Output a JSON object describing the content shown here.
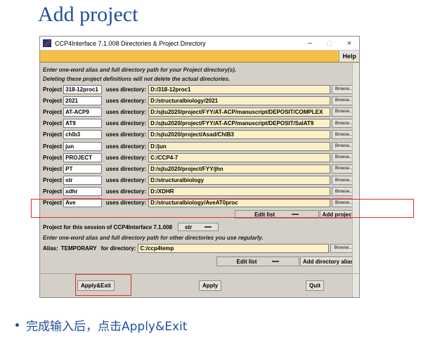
{
  "slide": {
    "title": "Add project",
    "bullet": "完成输入后，点击Apply&Exit"
  },
  "window": {
    "title": "CCP4Interface 7.1.008 Directories & Project Directory",
    "minimize": "−",
    "maximize": "□",
    "close": "×",
    "help": "Help"
  },
  "info": {
    "line1": "Enter one-word alias and full directory path for your Project directory(s).",
    "line2": "Deleting these project definitions will not delete the actual directories."
  },
  "labels": {
    "project": "Project",
    "uses_directory": "uses directory:",
    "browse": "Browse..."
  },
  "projects": [
    {
      "alias": "318-12proc1",
      "dir": "D:/318-12proc1"
    },
    {
      "alias": "2021",
      "dir": "D:/structuralbiology/2021"
    },
    {
      "alias": "AT-ACP9",
      "dir": "D:/sjtu2020/project/FYY/AT-ACP/manuscript/DEPOSIT/COMPLEX"
    },
    {
      "alias": "AT9",
      "dir": "D:/sjtu2020/project/FYY/AT-ACP/manuscript/DEPOSIT/SalAT9"
    },
    {
      "alias": "chlb3",
      "dir": "D:/sjtu2020/project/Asad/ChlB3"
    },
    {
      "alias": "jun",
      "dir": "D:/jun"
    },
    {
      "alias": "PROJECT",
      "dir": "C:/CCP4-7"
    },
    {
      "alias": "PT",
      "dir": "D:/sjtu2020/project/FYY/jhn"
    },
    {
      "alias": "str",
      "dir": "D:/structuralbiology"
    },
    {
      "alias": "xdhr",
      "dir": "D:/XDHR"
    },
    {
      "alias": "Ave",
      "dir": "D:/structuralbiology/AveAT0proc"
    }
  ],
  "project_controls": {
    "edit_list": "Edit list",
    "add_project": "Add project"
  },
  "session": {
    "label": "Project for this session of CCP4Interface 7.1.008",
    "value": "str"
  },
  "other_dirs": {
    "info": "Enter one-word alias and full directory path for other directories you use regularly.",
    "alias_label": "Alias:",
    "alias_value": "TEMPORARY",
    "for_directory": "for directory:",
    "dir_value": "C:/ccp4temp",
    "edit_list": "Edit list",
    "add_directory_alias": "Add directory alias"
  },
  "buttons": {
    "apply_exit": "Apply&Exit",
    "apply": "Apply",
    "quit": "Quit"
  },
  "colors": {
    "title_blue": "#1f4e9c",
    "menu_yellow": "#f5c04a",
    "field_yellow": "#fbf0c8",
    "highlight_red": "#e52b2b"
  }
}
